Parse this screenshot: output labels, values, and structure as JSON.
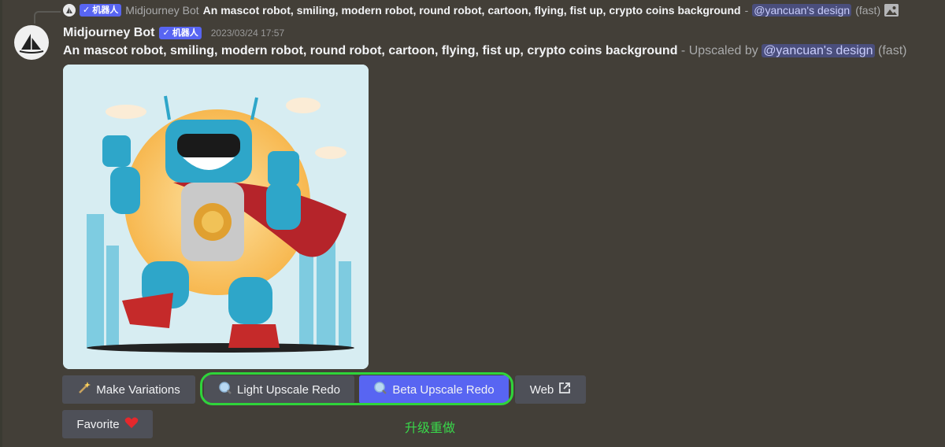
{
  "reply": {
    "bot_name": "Midjourney Bot",
    "badge": "✓ 机器人",
    "prompt": "An mascot robot, smiling, modern robot, round robot, cartoon, flying, fist up, crypto coins background",
    "separator": " - ",
    "mention": "@yancuan's design",
    "speed": "(fast)"
  },
  "message": {
    "username": "Midjourney Bot",
    "badge": "✓ 机器人",
    "timestamp": "2023/03/24 17:57",
    "prompt": "An mascot robot, smiling, modern robot, round robot, cartoon, flying, fist up, crypto coins background",
    "upscaled_text": " - Upscaled by ",
    "mention": "@yancuan's design",
    "speed": " (fast)"
  },
  "buttons": {
    "make_variations": "Make Variations",
    "light_upscale_redo": "Light Upscale Redo",
    "beta_upscale_redo": "Beta Upscale Redo",
    "web": "Web",
    "favorite": "Favorite"
  },
  "annotation": "升级重做",
  "icons": {
    "variations": "magic-wand-icon",
    "light": "magnifier-icon",
    "beta": "magnifier-icon",
    "web": "external-link-icon",
    "favorite": "heart-icon",
    "attachment": "image-icon"
  },
  "colors": {
    "background": "#433f38",
    "primary_button": "#5865f2",
    "secondary_button": "#4e5058",
    "highlight": "#2fd43a",
    "mention_bg": "#4a4e7c"
  }
}
